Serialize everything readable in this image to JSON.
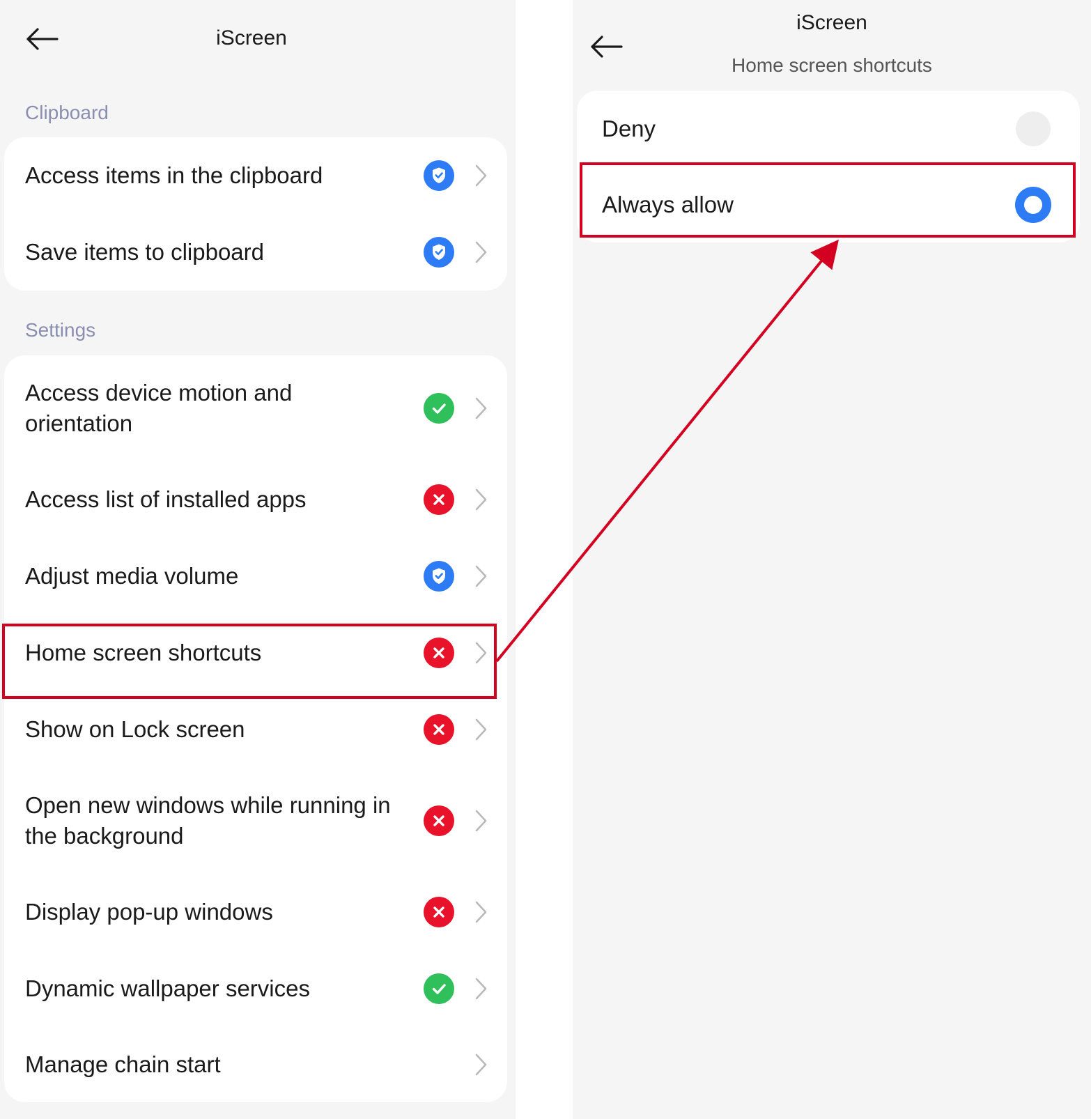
{
  "left_screen": {
    "title": "iScreen",
    "sections": [
      {
        "label": "Clipboard",
        "items": [
          {
            "label": "Access items in the clipboard",
            "status": "ask",
            "status_icon": "shield-check-icon"
          },
          {
            "label": "Save items to clipboard",
            "status": "ask",
            "status_icon": "shield-check-icon"
          }
        ]
      },
      {
        "label": "Settings",
        "items": [
          {
            "label": "Access device motion and orientation",
            "status": "allowed",
            "status_icon": "check-circle-icon"
          },
          {
            "label": "Access list of installed apps",
            "status": "denied",
            "status_icon": "x-circle-icon"
          },
          {
            "label": "Adjust media volume",
            "status": "ask",
            "status_icon": "shield-check-icon"
          },
          {
            "label": "Home screen shortcuts",
            "status": "denied",
            "status_icon": "x-circle-icon",
            "highlighted": true
          },
          {
            "label": "Show on Lock screen",
            "status": "denied",
            "status_icon": "x-circle-icon"
          },
          {
            "label": "Open new windows while running in the background",
            "status": "denied",
            "status_icon": "x-circle-icon"
          },
          {
            "label": "Display pop-up windows",
            "status": "denied",
            "status_icon": "x-circle-icon"
          },
          {
            "label": "Dynamic wallpaper services",
            "status": "allowed",
            "status_icon": "check-circle-icon"
          },
          {
            "label": "Manage chain start",
            "status": "none",
            "status_icon": ""
          }
        ]
      }
    ]
  },
  "right_screen": {
    "title": "iScreen",
    "subtitle": "Home screen shortcuts",
    "options": [
      {
        "label": "Deny",
        "selected": false
      },
      {
        "label": "Always allow",
        "selected": true,
        "highlighted": true
      }
    ]
  },
  "colors": {
    "ask": "#2d7cf6",
    "allowed": "#2fbf5b",
    "denied": "#e8132a",
    "highlight": "#d30021",
    "section_label": "#8a8fb0"
  }
}
